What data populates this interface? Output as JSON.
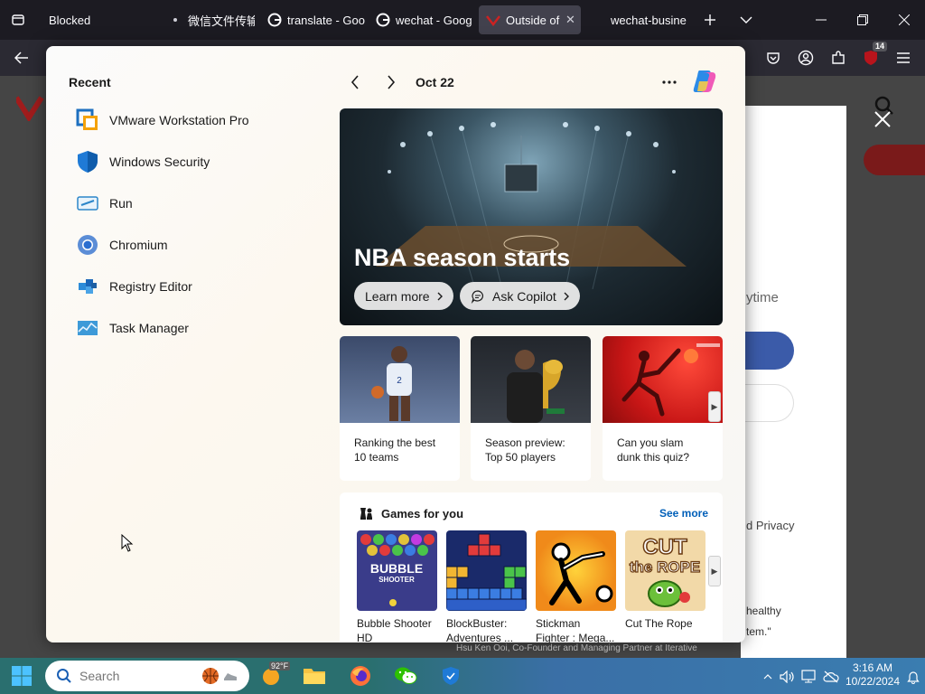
{
  "browser": {
    "tabs": [
      {
        "label": "Blocked",
        "favicon": "blocked-icon"
      },
      {
        "label": "微信文件传输",
        "favicon": "dot-icon"
      },
      {
        "label": "translate - Goo",
        "favicon": "google-icon"
      },
      {
        "label": "wechat - Goog",
        "favicon": "google-icon"
      },
      {
        "label": "Outside of t",
        "favicon": "site-icon",
        "active": true
      },
      {
        "label": "wechat-busine",
        "favicon": "none"
      }
    ],
    "extensions_badge": "14"
  },
  "webpage": {
    "fragments": [
      {
        "text": "ytime"
      },
      {
        "text": "d Privacy"
      },
      {
        "text": "healthy"
      },
      {
        "text": "tem.\""
      },
      {
        "text": "Hsu Ken Ooi, Co-Founder and Managing Partner at Iterative"
      }
    ]
  },
  "start_menu": {
    "recent_title": "Recent",
    "recent_apps": [
      {
        "label": "VMware Workstation Pro",
        "icon": "vmware-icon"
      },
      {
        "label": "Windows Security",
        "icon": "shield-icon"
      },
      {
        "label": "Run",
        "icon": "run-icon"
      },
      {
        "label": "Chromium",
        "icon": "chromium-icon"
      },
      {
        "label": "Registry Editor",
        "icon": "registry-icon"
      },
      {
        "label": "Task Manager",
        "icon": "task-manager-icon"
      }
    ],
    "date": "Oct 22",
    "hero": {
      "title": "NBA season starts",
      "learn_more": "Learn more",
      "ask_copilot": "Ask Copilot"
    },
    "news": [
      {
        "caption_1": "Ranking the best",
        "caption_2": "10 teams"
      },
      {
        "caption_1": "Season preview:",
        "caption_2": "Top 50 players"
      },
      {
        "caption_1": "Can you slam",
        "caption_2": "dunk this quiz?"
      }
    ],
    "games": {
      "title": "Games for you",
      "see_more": "See more",
      "items": [
        {
          "name_1": "Bubble Shooter",
          "name_2": "HD",
          "art_1": "BUBBLE",
          "art_2": "SHOOTER"
        },
        {
          "name_1": "BlockBuster:",
          "name_2": "Adventures ...",
          "art_1": "",
          "art_2": ""
        },
        {
          "name_1": "Stickman",
          "name_2": "Fighter : Mega...",
          "art_1": "",
          "art_2": ""
        },
        {
          "name_1": "Cut The Rope",
          "name_2": "",
          "art_1": "CUT",
          "art_2": "the ROPE"
        }
      ]
    }
  },
  "taskbar": {
    "search_placeholder": "Search",
    "weather": "92°F",
    "time": "3:16 AM",
    "date": "10/22/2024"
  },
  "colors": {
    "accent_blue": "#005fb8",
    "taskbar_teal": "#2a6f6f",
    "firefox_dark": "#1c1b22",
    "page_blue_button": "#3b5ba9"
  }
}
